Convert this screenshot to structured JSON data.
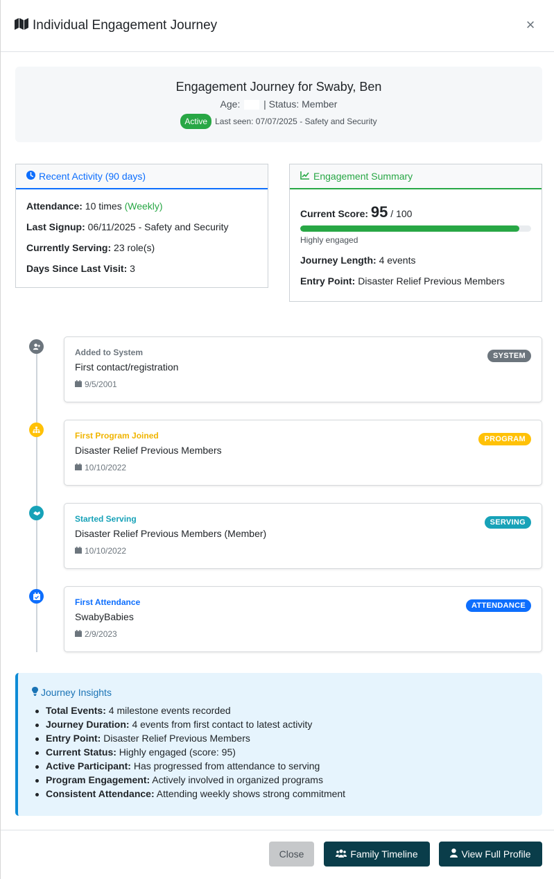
{
  "modal": {
    "title": "Individual Engagement Journey",
    "close_symbol": "×"
  },
  "hero": {
    "name": "Engagement Journey for Swaby, Ben",
    "age_label": "Age:",
    "status_text": "| Status: Member",
    "badge": "Active",
    "last_seen": "Last seen: 07/07/2025 - Safety and Security"
  },
  "recent": {
    "title": "Recent Activity (90 days)",
    "attendance_label": "Attendance:",
    "attendance_value": "10 times",
    "attendance_freq": "(Weekly)",
    "signup_label": "Last Signup:",
    "signup_value": "06/11/2025 - Safety and Security",
    "serving_label": "Currently Serving:",
    "serving_value": "23 role(s)",
    "days_label": "Days Since Last Visit:",
    "days_value": "3"
  },
  "summary": {
    "title": "Engagement Summary",
    "score_label": "Current Score:",
    "score": "95",
    "score_max": "/ 100",
    "score_fraction": 0.95,
    "score_caption": "Highly engaged",
    "length_label": "Journey Length:",
    "length_value": "4 events",
    "entry_label": "Entry Point:",
    "entry_value": "Disaster Relief Previous Members"
  },
  "events": [
    {
      "type": "Added to System",
      "description": "First contact/registration",
      "date": "9/5/2001",
      "tag": "SYSTEM",
      "color": "#6c757d",
      "icon": "user-plus-icon"
    },
    {
      "type": "First Program Joined",
      "description": "Disaster Relief Previous Members",
      "date": "10/10/2022",
      "tag": "PROGRAM",
      "color": "#ffc107",
      "icon": "sitemap-icon"
    },
    {
      "type": "Started Serving",
      "description": "Disaster Relief Previous Members (Member)",
      "date": "10/10/2022",
      "tag": "SERVING",
      "color": "#17a2b8",
      "icon": "handshake-icon"
    },
    {
      "type": "First Attendance",
      "description": "SwabyBabies",
      "date": "2/9/2023",
      "tag": "ATTENDANCE",
      "color": "#0d6efd",
      "icon": "calendar-check-icon"
    }
  ],
  "insights": {
    "title": "Journey Insights",
    "items": [
      {
        "label": "Total Events:",
        "text": "4 milestone events recorded"
      },
      {
        "label": "Journey Duration:",
        "text": "4 events from first contact to latest activity"
      },
      {
        "label": "Entry Point:",
        "text": "Disaster Relief Previous Members"
      },
      {
        "label": "Current Status:",
        "text": "Highly engaged (score: 95)"
      },
      {
        "label": "Active Participant:",
        "text": "Has progressed from attendance to serving"
      },
      {
        "label": "Program Engagement:",
        "text": "Actively involved in organized programs"
      },
      {
        "label": "Consistent Attendance:",
        "text": "Attending weekly shows strong commitment"
      }
    ]
  },
  "footer": {
    "close_label": "Close",
    "family_label": "Family Timeline",
    "profile_label": "View Full Profile"
  },
  "colors": {
    "accent_blue": "#0d6efd",
    "accent_green": "#28a745",
    "button_dark": "#0a3d4a"
  }
}
